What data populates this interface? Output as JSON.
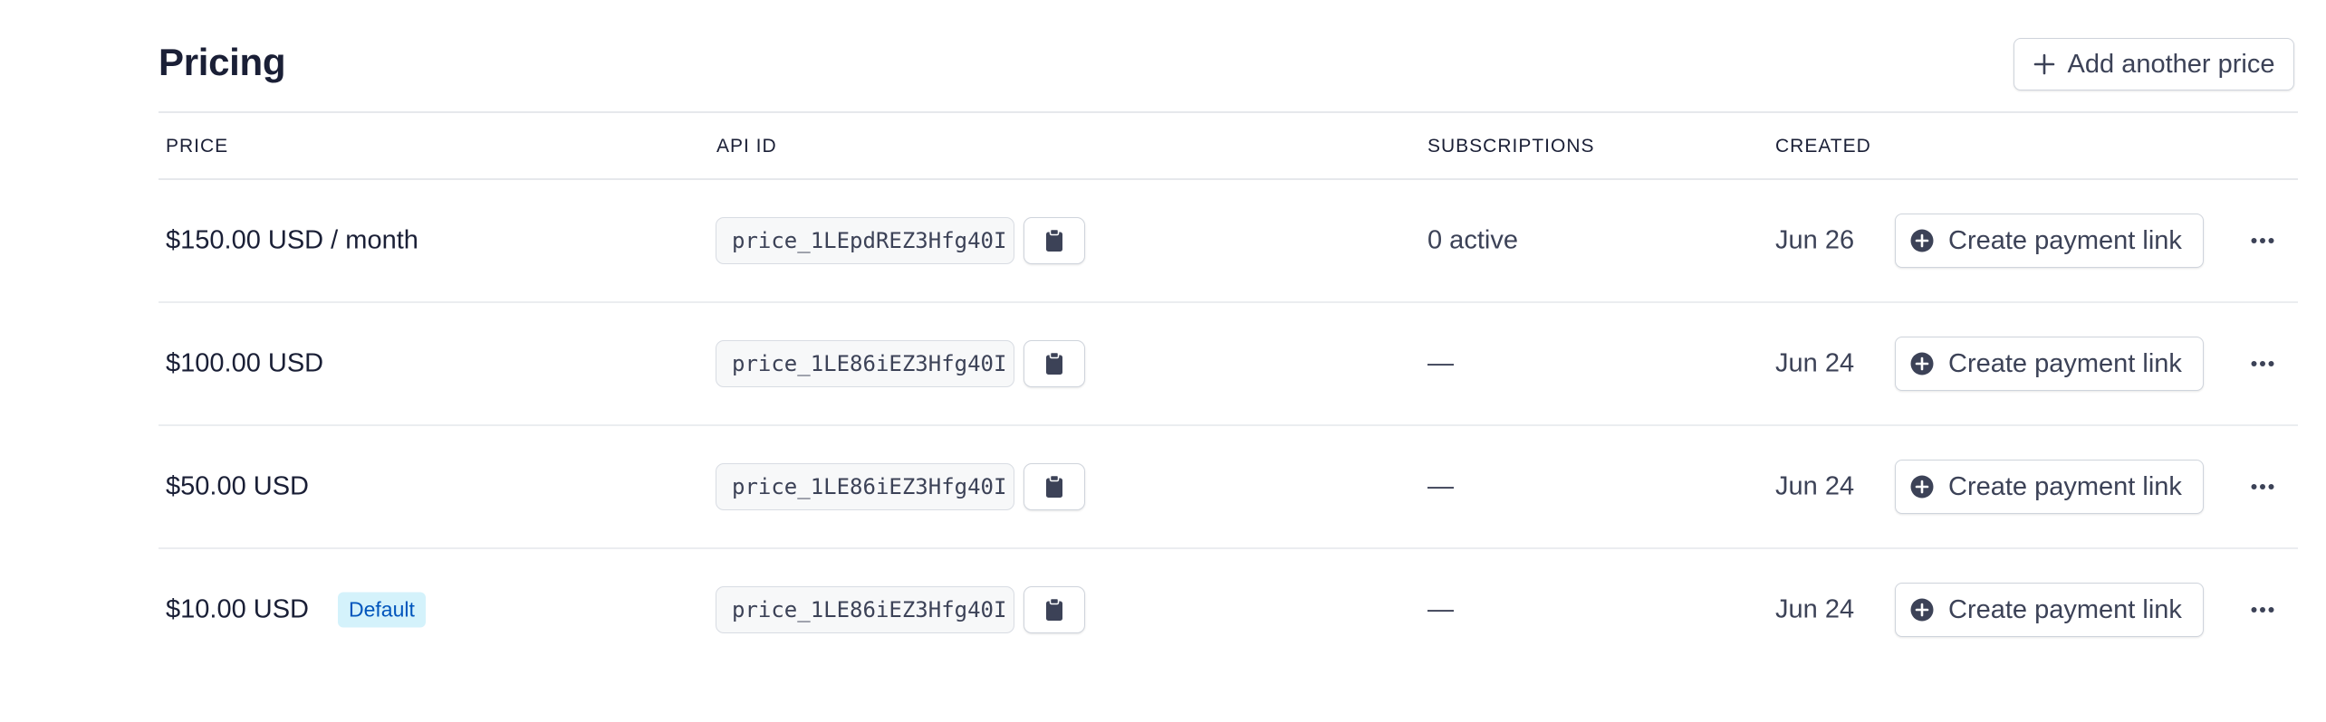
{
  "header": {
    "title": "Pricing",
    "add_price_label": "Add another price"
  },
  "table": {
    "columns": {
      "price": "PRICE",
      "api_id": "API ID",
      "subscriptions": "SUBSCRIPTIONS",
      "created": "CREATED"
    },
    "rows": [
      {
        "price": "$150.00 USD / month",
        "badge": "",
        "api_id": "price_1LEpdREZ3Hfg40I",
        "subscriptions": "0 active",
        "created": "Jun 26",
        "action": "Create payment link"
      },
      {
        "price": "$100.00 USD",
        "badge": "",
        "api_id": "price_1LE86iEZ3Hfg40I",
        "subscriptions": "—",
        "created": "Jun 24",
        "action": "Create payment link"
      },
      {
        "price": "$50.00 USD",
        "badge": "",
        "api_id": "price_1LE86iEZ3Hfg40I",
        "subscriptions": "—",
        "created": "Jun 24",
        "action": "Create payment link"
      },
      {
        "price": "$10.00 USD",
        "badge": "Default",
        "api_id": "price_1LE86iEZ3Hfg40I",
        "subscriptions": "—",
        "created": "Jun 24",
        "action": "Create payment link"
      }
    ]
  },
  "icons": {
    "add": "plus-icon",
    "copy": "clipboard-icon",
    "payment_link": "plus-circle-icon",
    "more": "ellipsis-icon"
  },
  "colors": {
    "text": "#1a1f36",
    "muted_text": "#3c4257",
    "border": "#cfd4dc",
    "badge_bg": "#d4f2fb",
    "badge_text": "#0055bc",
    "icon": "#3c4257"
  }
}
